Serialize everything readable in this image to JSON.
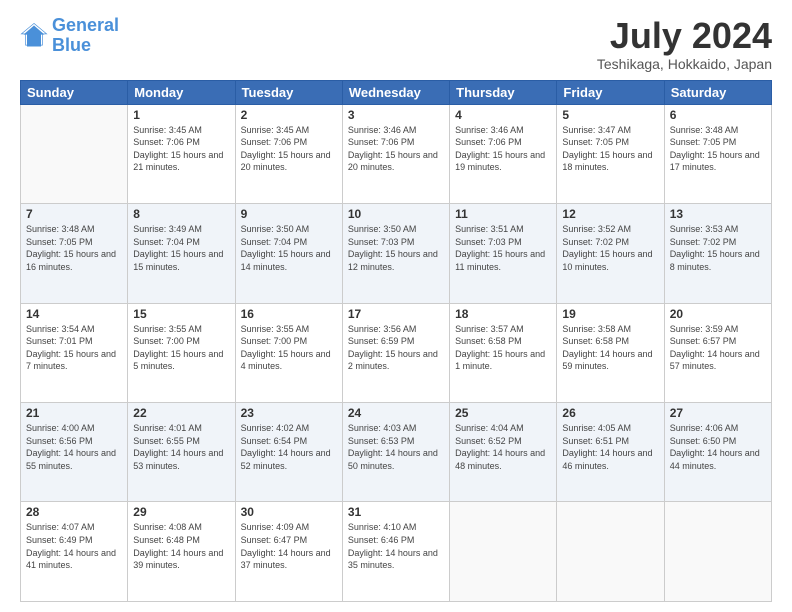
{
  "header": {
    "logo_line1": "General",
    "logo_line2": "Blue",
    "title": "July 2024",
    "subtitle": "Teshikaga, Hokkaido, Japan"
  },
  "calendar": {
    "weekdays": [
      "Sunday",
      "Monday",
      "Tuesday",
      "Wednesday",
      "Thursday",
      "Friday",
      "Saturday"
    ],
    "weeks": [
      [
        {
          "day": "",
          "empty": true
        },
        {
          "day": "1",
          "sunrise": "3:45 AM",
          "sunset": "7:06 PM",
          "daylight": "15 hours and 21 minutes."
        },
        {
          "day": "2",
          "sunrise": "3:45 AM",
          "sunset": "7:06 PM",
          "daylight": "15 hours and 20 minutes."
        },
        {
          "day": "3",
          "sunrise": "3:46 AM",
          "sunset": "7:06 PM",
          "daylight": "15 hours and 20 minutes."
        },
        {
          "day": "4",
          "sunrise": "3:46 AM",
          "sunset": "7:06 PM",
          "daylight": "15 hours and 19 minutes."
        },
        {
          "day": "5",
          "sunrise": "3:47 AM",
          "sunset": "7:05 PM",
          "daylight": "15 hours and 18 minutes."
        },
        {
          "day": "6",
          "sunrise": "3:48 AM",
          "sunset": "7:05 PM",
          "daylight": "15 hours and 17 minutes."
        }
      ],
      [
        {
          "day": "7",
          "sunrise": "3:48 AM",
          "sunset": "7:05 PM",
          "daylight": "15 hours and 16 minutes."
        },
        {
          "day": "8",
          "sunrise": "3:49 AM",
          "sunset": "7:04 PM",
          "daylight": "15 hours and 15 minutes."
        },
        {
          "day": "9",
          "sunrise": "3:50 AM",
          "sunset": "7:04 PM",
          "daylight": "15 hours and 14 minutes."
        },
        {
          "day": "10",
          "sunrise": "3:50 AM",
          "sunset": "7:03 PM",
          "daylight": "15 hours and 12 minutes."
        },
        {
          "day": "11",
          "sunrise": "3:51 AM",
          "sunset": "7:03 PM",
          "daylight": "15 hours and 11 minutes."
        },
        {
          "day": "12",
          "sunrise": "3:52 AM",
          "sunset": "7:02 PM",
          "daylight": "15 hours and 10 minutes."
        },
        {
          "day": "13",
          "sunrise": "3:53 AM",
          "sunset": "7:02 PM",
          "daylight": "15 hours and 8 minutes."
        }
      ],
      [
        {
          "day": "14",
          "sunrise": "3:54 AM",
          "sunset": "7:01 PM",
          "daylight": "15 hours and 7 minutes."
        },
        {
          "day": "15",
          "sunrise": "3:55 AM",
          "sunset": "7:00 PM",
          "daylight": "15 hours and 5 minutes."
        },
        {
          "day": "16",
          "sunrise": "3:55 AM",
          "sunset": "7:00 PM",
          "daylight": "15 hours and 4 minutes."
        },
        {
          "day": "17",
          "sunrise": "3:56 AM",
          "sunset": "6:59 PM",
          "daylight": "15 hours and 2 minutes."
        },
        {
          "day": "18",
          "sunrise": "3:57 AM",
          "sunset": "6:58 PM",
          "daylight": "15 hours and 1 minute."
        },
        {
          "day": "19",
          "sunrise": "3:58 AM",
          "sunset": "6:58 PM",
          "daylight": "14 hours and 59 minutes."
        },
        {
          "day": "20",
          "sunrise": "3:59 AM",
          "sunset": "6:57 PM",
          "daylight": "14 hours and 57 minutes."
        }
      ],
      [
        {
          "day": "21",
          "sunrise": "4:00 AM",
          "sunset": "6:56 PM",
          "daylight": "14 hours and 55 minutes."
        },
        {
          "day": "22",
          "sunrise": "4:01 AM",
          "sunset": "6:55 PM",
          "daylight": "14 hours and 53 minutes."
        },
        {
          "day": "23",
          "sunrise": "4:02 AM",
          "sunset": "6:54 PM",
          "daylight": "14 hours and 52 minutes."
        },
        {
          "day": "24",
          "sunrise": "4:03 AM",
          "sunset": "6:53 PM",
          "daylight": "14 hours and 50 minutes."
        },
        {
          "day": "25",
          "sunrise": "4:04 AM",
          "sunset": "6:52 PM",
          "daylight": "14 hours and 48 minutes."
        },
        {
          "day": "26",
          "sunrise": "4:05 AM",
          "sunset": "6:51 PM",
          "daylight": "14 hours and 46 minutes."
        },
        {
          "day": "27",
          "sunrise": "4:06 AM",
          "sunset": "6:50 PM",
          "daylight": "14 hours and 44 minutes."
        }
      ],
      [
        {
          "day": "28",
          "sunrise": "4:07 AM",
          "sunset": "6:49 PM",
          "daylight": "14 hours and 41 minutes."
        },
        {
          "day": "29",
          "sunrise": "4:08 AM",
          "sunset": "6:48 PM",
          "daylight": "14 hours and 39 minutes."
        },
        {
          "day": "30",
          "sunrise": "4:09 AM",
          "sunset": "6:47 PM",
          "daylight": "14 hours and 37 minutes."
        },
        {
          "day": "31",
          "sunrise": "4:10 AM",
          "sunset": "6:46 PM",
          "daylight": "14 hours and 35 minutes."
        },
        {
          "day": "",
          "empty": true
        },
        {
          "day": "",
          "empty": true
        },
        {
          "day": "",
          "empty": true
        }
      ]
    ]
  }
}
